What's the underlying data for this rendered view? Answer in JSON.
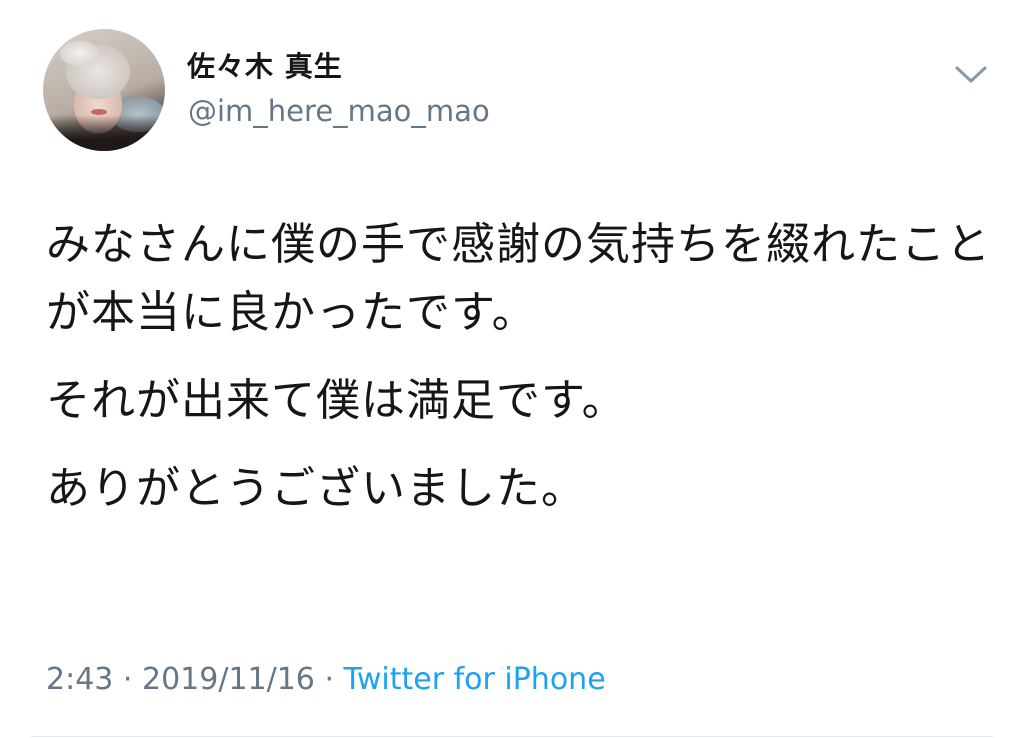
{
  "author": {
    "display_name": "佐々木 真生",
    "handle": "@im_here_mao_mao"
  },
  "tweet": {
    "paragraphs": [
      "みなさんに僕の手で感謝の気持ちを綴れたことが本当に良かったです。",
      "それが出来て僕は満足です。",
      "ありがとうございました。"
    ],
    "time": "2:43",
    "separator": " · ",
    "date": "2019/11/16",
    "source": "Twitter for iPhone"
  },
  "colors": {
    "text": "#14171a",
    "secondary": "#657786",
    "link": "#1da1f2"
  },
  "icons": {
    "menu": "chevron-down-icon"
  }
}
